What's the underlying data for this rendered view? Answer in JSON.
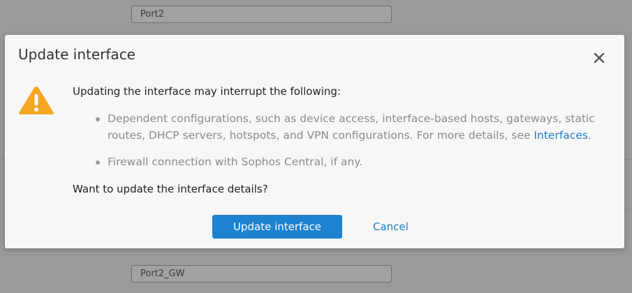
{
  "background": {
    "field_top_value": "Port2",
    "field_bottom_value": "Port2_GW"
  },
  "dialog": {
    "title": "Update interface",
    "close_icon": "close-icon",
    "warning_icon": "warning-triangle-icon",
    "intro": "Updating the interface may interrupt the following:",
    "bullets": {
      "item1_text": "Dependent configurations, such as device access, interface-based hosts, gateways, static routes, DHCP servers, hotspots, and VPN configurations. For more details, see ",
      "item1_link": "Interfaces",
      "item1_suffix": ".",
      "item2_text": "Firewall connection with Sophos Central, if any."
    },
    "question": "Want to update the interface details?",
    "primary_label": "Update interface",
    "cancel_label": "Cancel"
  },
  "colors": {
    "primary": "#1d82cf",
    "link": "#1e7fc6",
    "warning": "#f5a623"
  }
}
